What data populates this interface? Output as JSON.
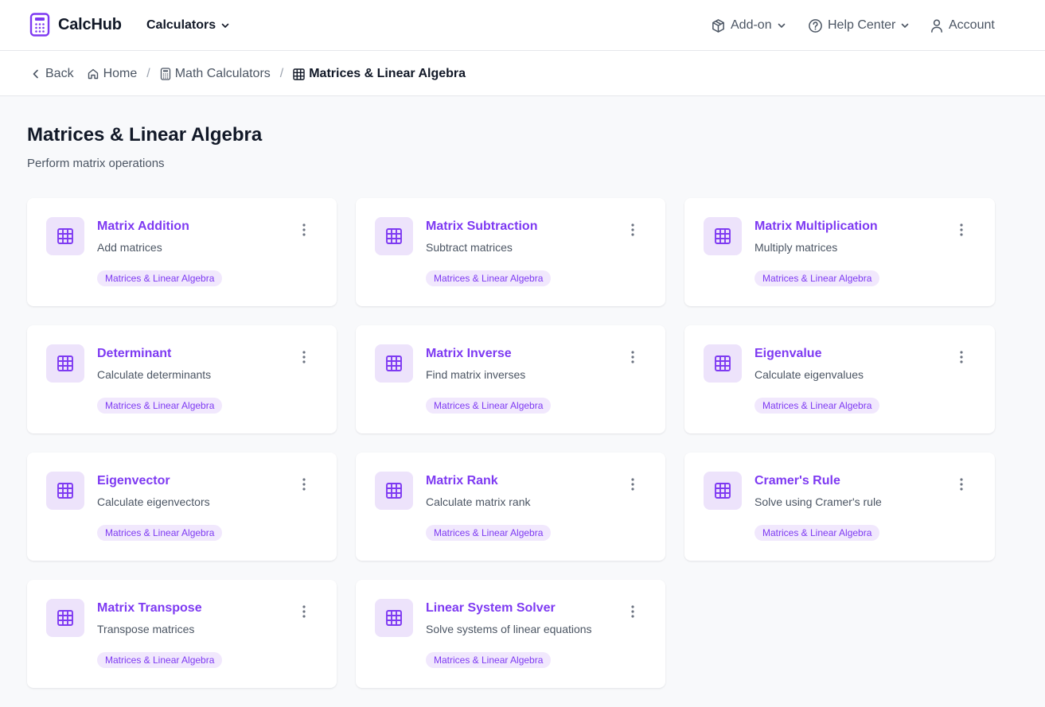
{
  "app": {
    "name": "CalcHub",
    "brand_color": "#7e3af2"
  },
  "nav": {
    "calculators_label": "Calculators",
    "addon_label": "Add-on",
    "help_label": "Help Center",
    "account_label": "Account"
  },
  "breadcrumb": {
    "back_label": "Back",
    "items": [
      "Home",
      "Math Calculators",
      "Matrices & Linear Algebra"
    ]
  },
  "page": {
    "title": "Matrices & Linear Algebra",
    "subtitle": "Perform matrix operations"
  },
  "cards": [
    {
      "title": "Matrix Addition",
      "description": "Add matrices",
      "tag": "Matrices & Linear Algebra",
      "icon": "grid-icon"
    },
    {
      "title": "Matrix Subtraction",
      "description": "Subtract matrices",
      "tag": "Matrices & Linear Algebra",
      "icon": "grid-icon"
    },
    {
      "title": "Matrix Multiplication",
      "description": "Multiply matrices",
      "tag": "Matrices & Linear Algebra",
      "icon": "grid-icon"
    },
    {
      "title": "Determinant",
      "description": "Calculate determinants",
      "tag": "Matrices & Linear Algebra",
      "icon": "grid-icon"
    },
    {
      "title": "Matrix Inverse",
      "description": "Find matrix inverses",
      "tag": "Matrices & Linear Algebra",
      "icon": "grid-icon"
    },
    {
      "title": "Eigenvalue",
      "description": "Calculate eigenvalues",
      "tag": "Matrices & Linear Algebra",
      "icon": "grid-icon"
    },
    {
      "title": "Eigenvector",
      "description": "Calculate eigenvectors",
      "tag": "Matrices & Linear Algebra",
      "icon": "grid-icon"
    },
    {
      "title": "Matrix Rank",
      "description": "Calculate matrix rank",
      "tag": "Matrices & Linear Algebra",
      "icon": "grid-icon"
    },
    {
      "title": "Cramer's Rule",
      "description": "Solve using Cramer's rule",
      "tag": "Matrices & Linear Algebra",
      "icon": "grid-icon"
    },
    {
      "title": "Matrix Transpose",
      "description": "Transpose matrices",
      "tag": "Matrices & Linear Algebra",
      "icon": "grid-icon"
    },
    {
      "title": "Linear System Solver",
      "description": "Solve systems of linear equations",
      "tag": "Matrices & Linear Algebra",
      "icon": "grid-icon"
    }
  ]
}
